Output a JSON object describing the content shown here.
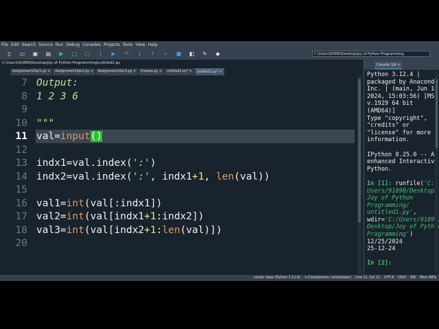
{
  "menu": [
    "File",
    "Edit",
    "Search",
    "Source",
    "Run",
    "Debug",
    "Consoles",
    "Projects",
    "Tools",
    "View",
    "Help"
  ],
  "toolbar": {
    "icons": [
      "new-file-icon",
      "open-file-icon",
      "save-icon",
      "save-all-icon",
      "run-icon",
      "run-cell-icon",
      "run-cell-advance-icon",
      "run-selection-icon",
      "debug-icon",
      "step-icon",
      "step-into-icon",
      "step-return-icon",
      "continue-icon",
      "stop-icon",
      "maximize-pane-icon",
      "preferences-icon",
      "python-path-icon"
    ],
    "working_dir": "C:\\Users\\91890\\Desktop\\Joy of Python Programming"
  },
  "editor": {
    "file_path": "C:\\Users\\91890\\Desktop\\Joy of Python Programming\\untitled2.py",
    "tabs": [
      {
        "label": "Assignment10pr1.py ✕"
      },
      {
        "label": "Assignment10pr2.py ✕"
      },
      {
        "label": "Assignment10pr3.py ✕"
      },
      {
        "label": "fnames.py ✕"
      },
      {
        "label": "untitled1.py* ✕"
      },
      {
        "label": "untitled2.py* ✕",
        "active": true
      }
    ],
    "current_line": 11,
    "lines": [
      {
        "n": "7",
        "tokens": [
          {
            "t": "Output:",
            "c": "doc"
          }
        ]
      },
      {
        "n": "8",
        "tokens": [
          {
            "t": "1 2 3 6",
            "c": "doc"
          }
        ]
      },
      {
        "n": "9",
        "tokens": []
      },
      {
        "n": "10",
        "tokens": [
          {
            "t": "\"\"\"",
            "c": "doc"
          }
        ]
      },
      {
        "n": "11",
        "tokens": [
          {
            "t": "val=",
            "c": ""
          },
          {
            "t": "input",
            "c": "kw"
          },
          {
            "t": "()",
            "c": "hl"
          }
        ]
      },
      {
        "n": "12",
        "tokens": []
      },
      {
        "n": "13",
        "tokens": [
          {
            "t": "indx1=val.index(",
            "c": ""
          },
          {
            "t": "':'",
            "c": "str"
          },
          {
            "t": ")",
            "c": ""
          }
        ]
      },
      {
        "n": "14",
        "tokens": [
          {
            "t": "indx2=val.index(",
            "c": ""
          },
          {
            "t": "':'",
            "c": "str"
          },
          {
            "t": ", indx1",
            "c": ""
          },
          {
            "t": "+1",
            "c": "num"
          },
          {
            "t": ", ",
            "c": ""
          },
          {
            "t": "len",
            "c": "kw"
          },
          {
            "t": "(val))",
            "c": ""
          }
        ]
      },
      {
        "n": "15",
        "tokens": []
      },
      {
        "n": "16",
        "tokens": [
          {
            "t": "val1=",
            "c": ""
          },
          {
            "t": "int",
            "c": "kw"
          },
          {
            "t": "(val[:indx1])",
            "c": ""
          }
        ]
      },
      {
        "n": "17",
        "tokens": [
          {
            "t": "val2=",
            "c": ""
          },
          {
            "t": "int",
            "c": "kw"
          },
          {
            "t": "(val[indx1",
            "c": ""
          },
          {
            "t": "+1",
            "c": "num"
          },
          {
            "t": ":indx2])",
            "c": ""
          }
        ]
      },
      {
        "n": "18",
        "tokens": [
          {
            "t": "val3=",
            "c": ""
          },
          {
            "t": "int",
            "c": "kw"
          },
          {
            "t": "(val[indx2",
            "c": ""
          },
          {
            "t": "+1",
            "c": "num"
          },
          {
            "t": ":",
            "c": ""
          },
          {
            "t": "len",
            "c": "kw"
          },
          {
            "t": "(val)])",
            "c": ""
          }
        ]
      },
      {
        "n": "20",
        "tokens": []
      }
    ]
  },
  "console": {
    "tab_label": "Console 1/A ✕",
    "banner": "Python 3.12.4 |\npackaged by Anaconda,\nInc. | (main, Jun 18\n2024, 15:03:56) [MSC\nv.1929 64 bit\n(AMD64)]\nType \"copyright\",\n\"credits\" or\n\"license\" for more\ninformation.\n\nIPython 8.25.0 -- An\nenhanced Interactive\nPython.\n",
    "prompt1": "In [1]:",
    "cmd_a": " runfile(",
    "cmd_b": "'C:/\nUsers/91890/Desktop/\nJoy of Python\nProgramming/\nuntitled1.py'",
    "cmd_c": ",\nwdir=",
    "cmd_d": "'C:/Users/91890/\nDesktop/Joy of Python\nProgramming'",
    "cmd_e": ")",
    "output": "12/25/2024\n25-12-24\n",
    "prompt2": "In [2]:"
  },
  "status": [
    "conda: base (Python 3.12.4)",
    "⟲ Completions: conda(base)",
    "Line 11, Col 12",
    "UTF-8",
    "CRLF",
    "RW",
    "Mem 88%"
  ],
  "colors": {
    "background": "#19232d",
    "panel": "#37414f",
    "accent": "#3a9bdc",
    "green": "#3ec46d"
  }
}
